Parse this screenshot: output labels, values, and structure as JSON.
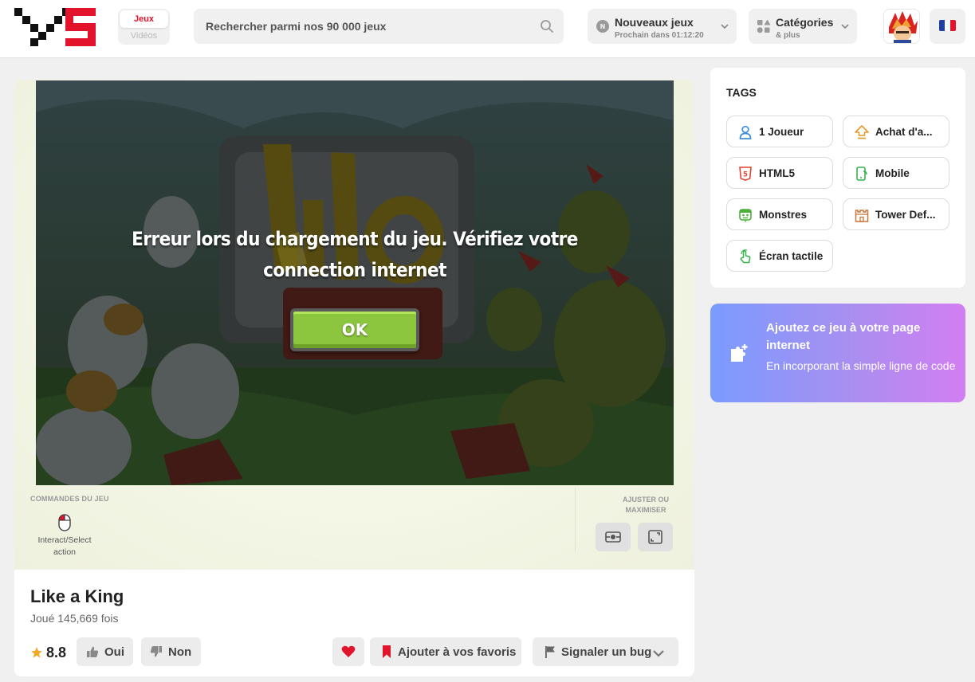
{
  "header": {
    "segments": {
      "active": "Jeux",
      "inactive": "Vidéos"
    },
    "search_placeholder": "Rechercher parmi nos 90 000 jeux",
    "new_games": {
      "title": "Nouveaux jeux",
      "subtitle": "Prochain dans 01:12:20"
    },
    "categories": {
      "title": "Catégories",
      "subtitle": "& plus"
    }
  },
  "game": {
    "error_line1": "Erreur lors du chargement du jeu. Vérifiez votre",
    "error_line2": "connection internet",
    "ok_label": "OK",
    "controls_title": "COMMANDES DU JEU",
    "control_action_line1": "Interact/Select",
    "control_action_line2": "action",
    "fit_title_line1": "AJUSTER OU",
    "fit_title_line2": "MAXIMISER"
  },
  "info": {
    "title": "Like a King",
    "plays": "Joué 145,669 fois",
    "rating": "8.8",
    "yes_label": "Oui",
    "no_label": "Non",
    "favorite_label": "Ajouter à vos favoris",
    "bug_label": "Signaler un bug"
  },
  "tags": {
    "heading": "TAGS",
    "items": [
      {
        "label": "1 Joueur",
        "icon": "user-icon",
        "color": "#3b8ed8"
      },
      {
        "label": "Achat d'a...",
        "icon": "upgrade-arrow-icon",
        "color": "#e39a2d"
      },
      {
        "label": "HTML5",
        "icon": "html5-icon",
        "color": "#e2442f"
      },
      {
        "label": "Mobile",
        "icon": "mobile-icon",
        "color": "#36b24a"
      },
      {
        "label": "Monstres",
        "icon": "monster-icon",
        "color": "#4caf3a"
      },
      {
        "label": "Tower Def...",
        "icon": "castle-icon",
        "color": "#c8763a"
      },
      {
        "label": "Écran tactile",
        "icon": "touch-icon",
        "color": "#36b24a"
      }
    ]
  },
  "embed": {
    "title": "Ajoutez ce jeu à votre page internet",
    "subtitle": "En incorporant la simple ligne de code"
  },
  "colors": {
    "brand_red": "#e2142b",
    "ok_green": "#8cc63f",
    "heart": "#e2142b"
  }
}
